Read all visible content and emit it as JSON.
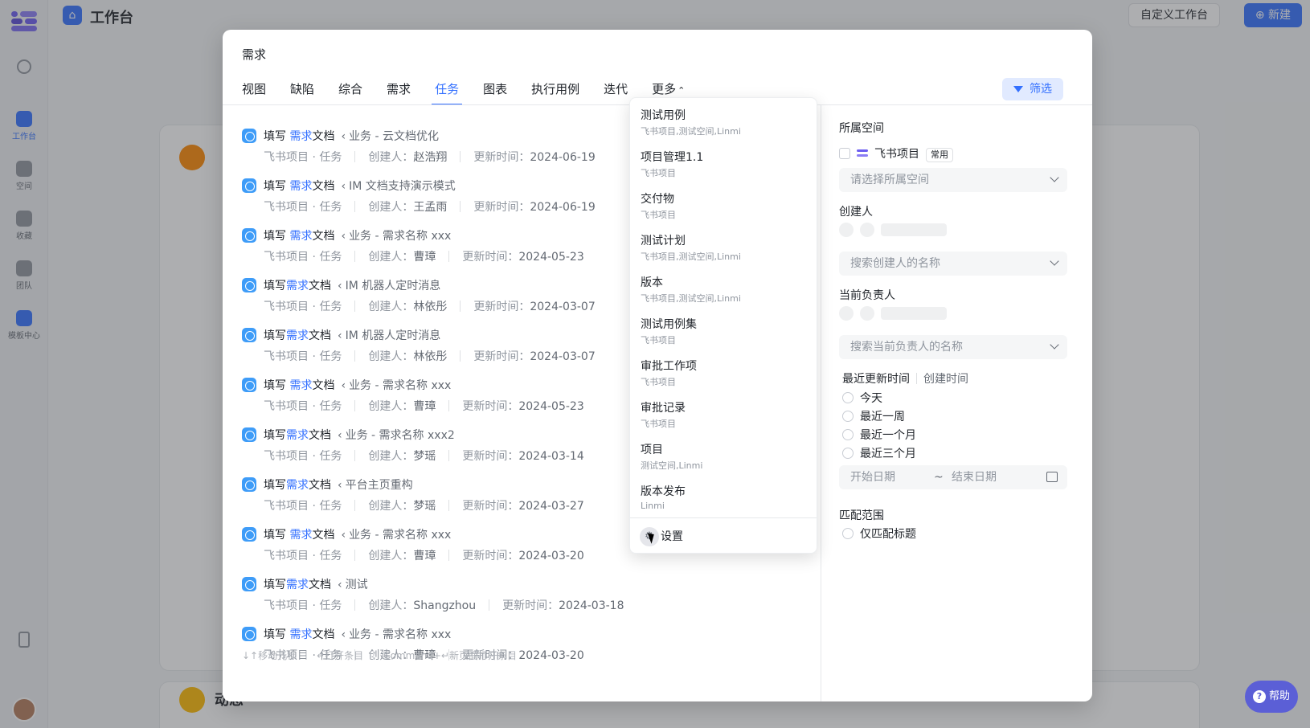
{
  "app": {
    "title": "工作台",
    "custom_btn": "自定义工作台",
    "new_btn": "新建",
    "rail": [
      "工作台",
      "空间",
      "收藏",
      "团队",
      "模板中心"
    ],
    "bg_card_title": "动态",
    "help": "帮助"
  },
  "modal": {
    "title": "需求",
    "tabs": [
      "视图",
      "缺陷",
      "综合",
      "需求",
      "任务",
      "图表",
      "执行用例",
      "迭代",
      "更多"
    ],
    "active_tab": "任务",
    "filter_btn": "筛选",
    "results": [
      {
        "pre": "填写 ",
        "kw": "需求",
        "post": "文档",
        "crumb": "业务 - 云文档优化",
        "space": "飞书项目 · 任务",
        "creator_label": "创建人：",
        "creator": "赵浩翔",
        "time_label": "更新时间：",
        "time": "2024-06-19"
      },
      {
        "pre": "填写 ",
        "kw": "需求",
        "post": "文档",
        "crumb": "IM 文档支持演示模式",
        "space": "飞书项目 · 任务",
        "creator_label": "创建人：",
        "creator": "王孟雨",
        "time_label": "更新时间：",
        "time": "2024-06-19"
      },
      {
        "pre": "填写 ",
        "kw": "需求",
        "post": "文档",
        "crumb": "业务 - 需求名称 xxx",
        "space": "飞书项目 · 任务",
        "creator_label": "创建人：",
        "creator": "曹璋",
        "time_label": "更新时间：",
        "time": "2024-05-23"
      },
      {
        "pre": "填写",
        "kw": "需求",
        "post": "文档",
        "crumb": "IM 机器人定时消息",
        "space": "飞书项目 · 任务",
        "creator_label": "创建人：",
        "creator": "林依彤",
        "time_label": "更新时间：",
        "time": "2024-03-07"
      },
      {
        "pre": "填写",
        "kw": "需求",
        "post": "文档",
        "crumb": "IM 机器人定时消息",
        "space": "飞书项目 · 任务",
        "creator_label": "创建人：",
        "creator": "林依彤",
        "time_label": "更新时间：",
        "time": "2024-03-07"
      },
      {
        "pre": "填写 ",
        "kw": "需求",
        "post": "文档",
        "crumb": "业务 - 需求名称 xxx",
        "space": "飞书项目 · 任务",
        "creator_label": "创建人：",
        "creator": "曹璋",
        "time_label": "更新时间：",
        "time": "2024-05-23"
      },
      {
        "pre": "填写",
        "kw": "需求",
        "post": "文档",
        "crumb": "业务 - 需求名称 xxx2",
        "space": "飞书项目 · 任务",
        "creator_label": "创建人：",
        "creator": "梦瑶",
        "time_label": "更新时间：",
        "time": "2024-03-14"
      },
      {
        "pre": "填写",
        "kw": "需求",
        "post": "文档",
        "crumb": "平台主页重构",
        "space": "飞书项目 · 任务",
        "creator_label": "创建人：",
        "creator": "梦瑶",
        "time_label": "更新时间：",
        "time": "2024-03-27"
      },
      {
        "pre": "填写 ",
        "kw": "需求",
        "post": "文档",
        "crumb": "业务 - 需求名称 xxx",
        "space": "飞书项目 · 任务",
        "creator_label": "创建人：",
        "creator": "曹璋",
        "time_label": "更新时间：",
        "time": "2024-03-20"
      },
      {
        "pre": "填写",
        "kw": "需求",
        "post": "文档",
        "crumb": "测试",
        "space": "飞书项目 · 任务",
        "creator_label": "创建人：",
        "creator": "Shangzhou",
        "time_label": "更新时间：",
        "time": "2024-03-18"
      },
      {
        "pre": "填写 ",
        "kw": "需求",
        "post": "文档",
        "crumb": "业务 - 需求名称 xxx",
        "space": "飞书项目 · 任务",
        "creator_label": "创建人：",
        "creator": "曹璋",
        "time_label": "更新时间：",
        "time": "2024-03-20"
      }
    ],
    "footer": [
      "↓↑移动光标",
      "↵打开条目",
      "Command+↵新页面打开条目"
    ]
  },
  "more_menu": {
    "items": [
      {
        "name": "测试用例",
        "sub": "飞书项目,测试空间,Linmi"
      },
      {
        "name": "项目管理1.1",
        "sub": "飞书项目"
      },
      {
        "name": "交付物",
        "sub": "飞书项目"
      },
      {
        "name": "测试计划",
        "sub": "飞书项目,测试空间,Linmi"
      },
      {
        "name": "版本",
        "sub": "飞书项目,测试空间,Linmi"
      },
      {
        "name": "测试用例集",
        "sub": "飞书项目"
      },
      {
        "name": "审批工作项",
        "sub": "飞书项目"
      },
      {
        "name": "审批记录",
        "sub": "飞书项目"
      },
      {
        "name": "项目",
        "sub": "测试空间,Linmi"
      },
      {
        "name": "版本发布",
        "sub": "Linmi"
      }
    ],
    "settings": "设置"
  },
  "filters": {
    "space_label": "所属空间",
    "space_name": "飞书项目",
    "space_tag": "常用",
    "space_placeholder": "请选择所属空间",
    "creator_label": "创建人",
    "creator_placeholder": "搜索创建人的名称",
    "owner_label": "当前负责人",
    "owner_placeholder": "搜索当前负责人的名称",
    "time_tab_active": "最近更新时间",
    "time_tab_other": "创建时间",
    "time_options": [
      "今天",
      "最近一周",
      "最近一个月",
      "最近三个月"
    ],
    "start_date": "开始日期",
    "date_sep": "~",
    "end_date": "结束日期",
    "match_label": "匹配范围",
    "match_option": "仅匹配标题"
  }
}
